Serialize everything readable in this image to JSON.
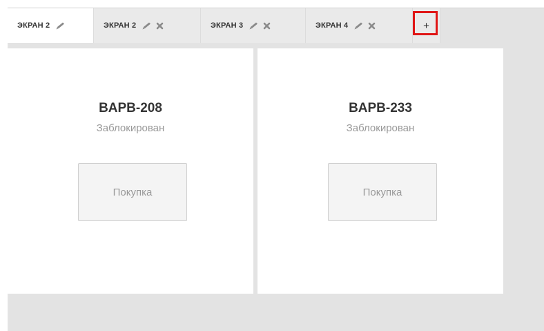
{
  "tabs": [
    {
      "label": "ЭКРАН 2",
      "active": true,
      "icons": [
        "pencil-icon"
      ]
    },
    {
      "label": "ЭКРАН 2",
      "active": false,
      "icons": [
        "pencil-icon",
        "close-icon"
      ]
    },
    {
      "label": "ЭКРАН 3",
      "active": false,
      "icons": [
        "pencil-icon",
        "close-icon"
      ]
    },
    {
      "label": "ЭКРАН 4",
      "active": false,
      "icons": [
        "pencil-icon",
        "close-icon"
      ]
    }
  ],
  "add_tab_label": "+",
  "panels": [
    {
      "title": "BAPB-208",
      "status": "Заблокирован",
      "button_label": "Покупка"
    },
    {
      "title": "BAPB-233",
      "status": "Заблокирован",
      "button_label": "Покупка"
    }
  ],
  "colors": {
    "highlight": "#e01616",
    "background": "#e3e3e3",
    "tab_inactive": "#eaeaea",
    "panel": "#ffffff"
  }
}
